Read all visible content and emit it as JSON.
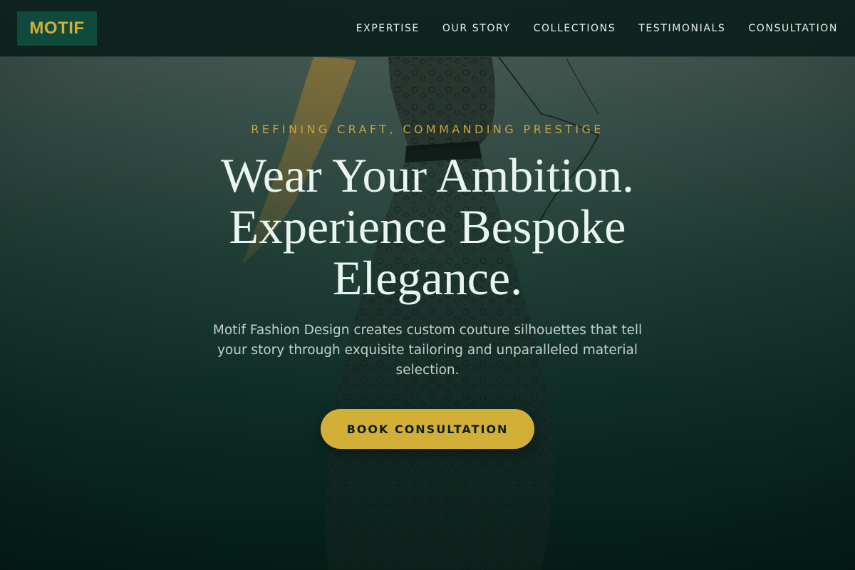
{
  "brand": {
    "logo_text": "MOTIF"
  },
  "nav": {
    "items": [
      {
        "label": "EXPERTISE"
      },
      {
        "label": "OUR STORY"
      },
      {
        "label": "COLLECTIONS"
      },
      {
        "label": "TESTIMONIALS"
      },
      {
        "label": "CONSULTATION"
      }
    ]
  },
  "hero": {
    "tagline": "REFINING CRAFT, COMMANDING PRESTIGE",
    "headline_lines": [
      "Wear Your Ambition.",
      "Experience Bespoke",
      "Elegance."
    ],
    "description_lines": [
      "Motif Fashion Design creates custom couture silhouettes that tell",
      "your story through exquisite tailoring and unparalleled material",
      "selection."
    ],
    "cta_label": "BOOK CONSULTATION",
    "background_image": "fashion-sketch-lace-gown"
  },
  "colors": {
    "accent_gold": "#d4af37",
    "logo_bg": "#0f4a3c",
    "navbar_bg": "#081c19",
    "headline_text": "#e8f5f1"
  }
}
